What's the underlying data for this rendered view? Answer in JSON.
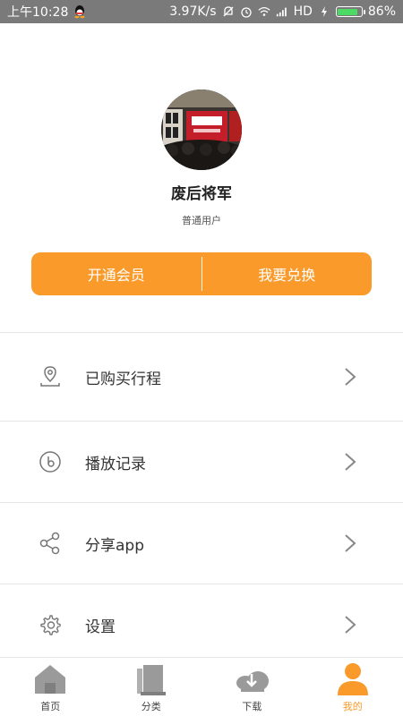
{
  "status_bar": {
    "time": "上午10:28",
    "speed": "3.97K/s",
    "network": "HD",
    "battery_percent": "86%",
    "battery_level": 0.86
  },
  "profile": {
    "username": "废后将军",
    "user_type": "普通用户",
    "vip_label": "开通会员",
    "redeem_label": "我要兑换",
    "accent_color": "#f99a2b"
  },
  "menu": [
    {
      "label": "已购买行程",
      "icon": "location-pin-icon"
    },
    {
      "label": "播放记录",
      "icon": "play-history-icon"
    },
    {
      "label": "分享app",
      "icon": "share-icon"
    },
    {
      "label": "设置",
      "icon": "gear-icon"
    }
  ],
  "nav": [
    {
      "label": "首页",
      "icon": "home-icon",
      "active": false
    },
    {
      "label": "分类",
      "icon": "category-icon",
      "active": false
    },
    {
      "label": "下载",
      "icon": "download-icon",
      "active": false
    },
    {
      "label": "我的",
      "icon": "user-icon",
      "active": true
    }
  ]
}
